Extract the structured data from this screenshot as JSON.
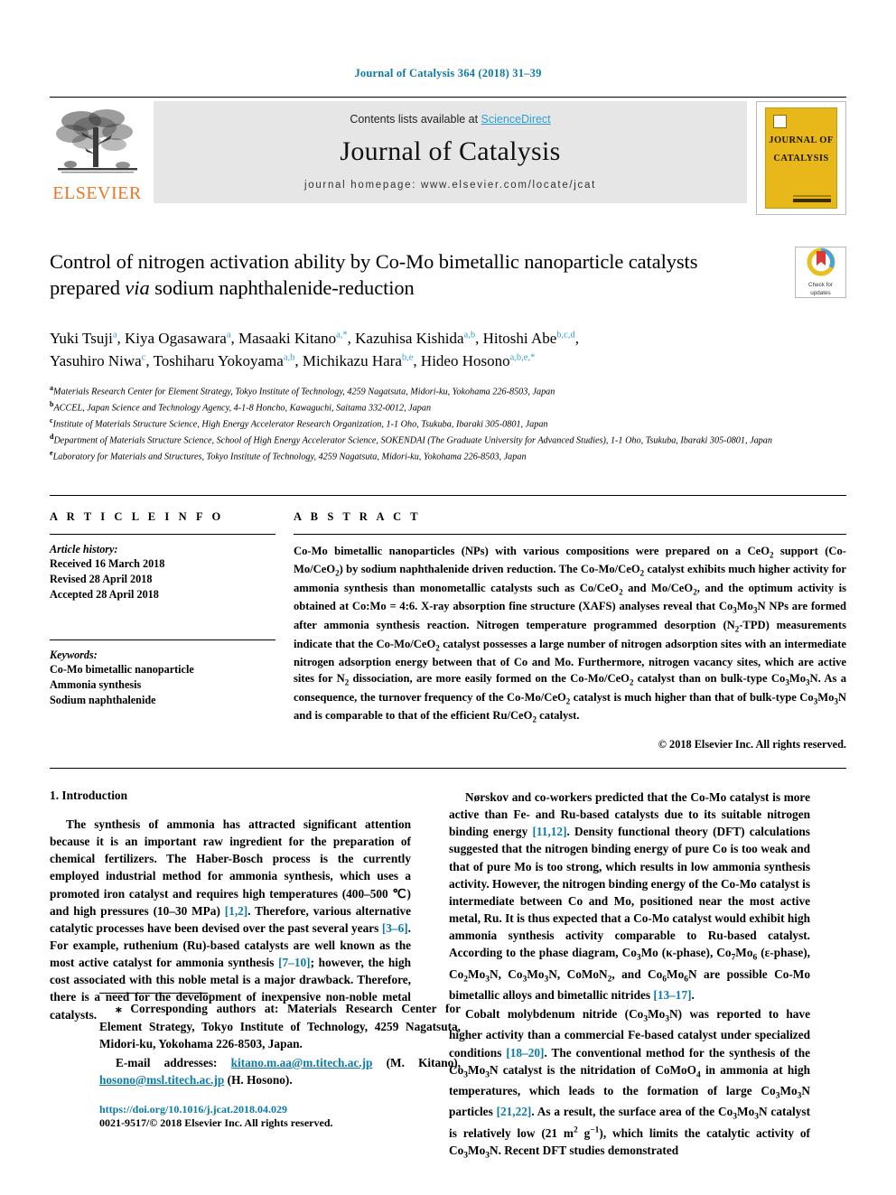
{
  "running_head": "Journal of Catalysis 364 (2018) 31–39",
  "masthead": {
    "publisher": "ELSEVIER",
    "contents_prefix": "Contents lists available at ",
    "contents_link": "ScienceDirect",
    "journal_title": "Journal of Catalysis",
    "homepage": "journal homepage: www.elsevier.com/locate/jcat",
    "cover_line1": "JOURNAL OF",
    "cover_line2": "CATALYSIS"
  },
  "article": {
    "title_part1": "Control of nitrogen activation ability by Co-Mo bimetallic nanoparticle catalysts prepared ",
    "title_italic": "via",
    "title_part2": " sodium naphthalenide-reduction",
    "crossmark_line1": "Check for",
    "crossmark_line2": "updates",
    "authors": [
      {
        "name": "Yuki Tsuji",
        "marks": "a"
      },
      {
        "name": "Kiya Ogasawara",
        "marks": "a"
      },
      {
        "name": "Masaaki Kitano",
        "marks": "a,*"
      },
      {
        "name": "Kazuhisa Kishida",
        "marks": "a,b"
      },
      {
        "name": "Hitoshi Abe",
        "marks": "b,c,d"
      },
      {
        "name": "Yasuhiro Niwa",
        "marks": "c"
      },
      {
        "name": "Toshiharu Yokoyama",
        "marks": "a,b"
      },
      {
        "name": "Michikazu Hara",
        "marks": "b,e"
      },
      {
        "name": "Hideo Hosono",
        "marks": "a,b,e,*"
      }
    ],
    "affiliations": [
      {
        "mark": "a",
        "text": "Materials Research Center for Element Strategy, Tokyo Institute of Technology, 4259 Nagatsuta, Midori-ku, Yokohama 226-8503, Japan"
      },
      {
        "mark": "b",
        "text": "ACCEL, Japan Science and Technology Agency, 4-1-8 Honcho, Kawaguchi, Saitama 332-0012, Japan"
      },
      {
        "mark": "c",
        "text": "Institute of Materials Structure Science, High Energy Accelerator Research Organization, 1-1 Oho, Tsukuba, Ibaraki 305-0801, Japan"
      },
      {
        "mark": "d",
        "text": "Department of Materials Structure Science, School of High Energy Accelerator Science, SOKENDAI (The Graduate University for Advanced Studies), 1-1 Oho, Tsukuba, Ibaraki 305-0801, Japan"
      },
      {
        "mark": "e",
        "text": "Laboratory for Materials and Structures, Tokyo Institute of Technology, 4259 Nagatsuta, Midori-ku, Yokohama 226-8503, Japan"
      }
    ]
  },
  "article_info": {
    "heading": "A R T I C L E    I N F O",
    "history_label": "Article history:",
    "history": [
      "Received 16 March 2018",
      "Revised 28 April 2018",
      "Accepted 28 April 2018"
    ],
    "keywords_label": "Keywords:",
    "keywords": [
      "Co-Mo bimetallic nanoparticle",
      "Ammonia synthesis",
      "Sodium naphthalenide"
    ]
  },
  "abstract": {
    "heading": "A B S T R A C T",
    "copyright": "© 2018 Elsevier Inc. All rights reserved."
  },
  "intro": {
    "heading": "1. Introduction"
  },
  "footnotes": {
    "corresponding_marker": "⁎",
    "email_label": "E-mail addresses:",
    "email1": "kitano.m.aa@m.titech.ac.jp",
    "email1_who": " (M. Kitano), ",
    "email2": "hosono@msl.titech.ac.jp",
    "email2_who": " (H. Hosono).",
    "doi": "https://doi.org/10.1016/j.jcat.2018.04.029",
    "issn": "0021-9517/© 2018 Elsevier Inc. All rights reserved."
  },
  "colors": {
    "link_blue": "#0b7aa8",
    "sciencedirect_blue": "#2a9fd6",
    "elsevier_orange": "#ee7623",
    "cover_yellow": "#e8b71a"
  }
}
